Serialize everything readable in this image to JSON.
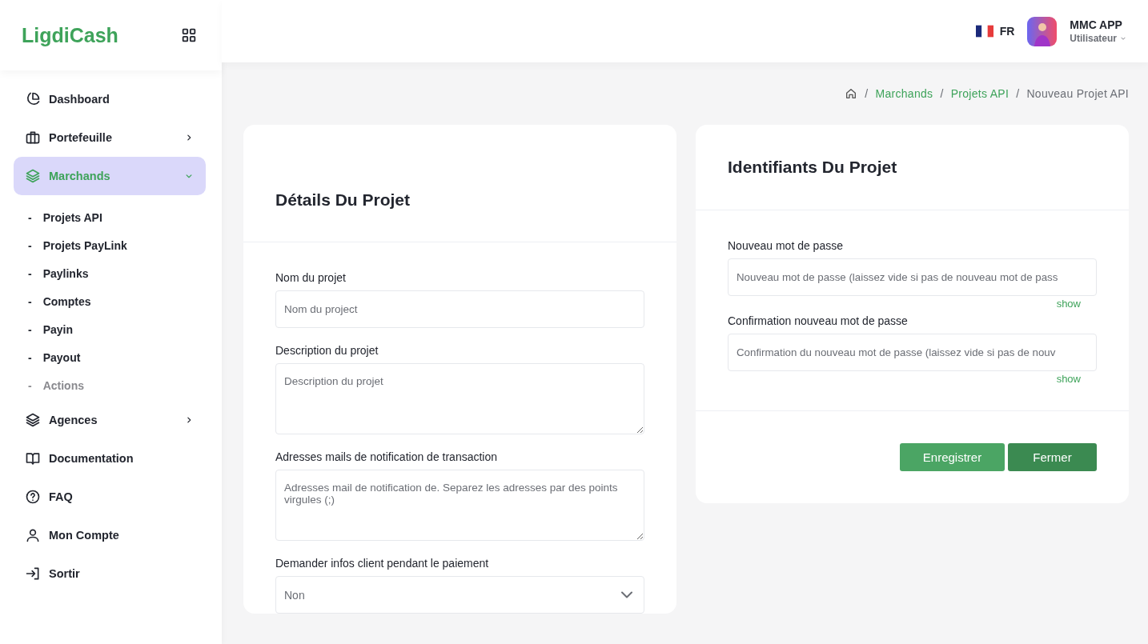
{
  "brand": {
    "name": "LigdiCash"
  },
  "header": {
    "language": "FR",
    "user_name": "MMC APP",
    "user_role": "Utilisateur"
  },
  "sidebar": {
    "items": [
      {
        "label": "Dashboard",
        "kind": "link",
        "selected": false
      },
      {
        "label": "Portefeuille",
        "kind": "group",
        "selected": false,
        "expanded": false
      },
      {
        "label": "Marchands",
        "kind": "group",
        "selected": true,
        "expanded": true,
        "children": [
          {
            "marker": "-",
            "label": "Projets API",
            "dimmed": false
          },
          {
            "marker": "-",
            "label": "Projets PayLink",
            "dimmed": false
          },
          {
            "marker": "-",
            "label": "Paylinks",
            "dimmed": false
          },
          {
            "marker": "-",
            "label": "Comptes",
            "dimmed": false
          },
          {
            "marker": "-",
            "label": "Payin",
            "dimmed": false
          },
          {
            "marker": "-",
            "label": "Payout",
            "dimmed": false
          },
          {
            "marker": "-",
            "label": "Actions",
            "dimmed": true
          }
        ]
      },
      {
        "label": "Agences",
        "kind": "group",
        "selected": false,
        "expanded": false
      },
      {
        "label": "Documentation",
        "kind": "link",
        "selected": false
      },
      {
        "label": "FAQ",
        "kind": "link",
        "selected": false
      },
      {
        "label": "Mon Compte",
        "kind": "link",
        "selected": false
      },
      {
        "label": "Sortir",
        "kind": "link",
        "selected": false
      }
    ]
  },
  "breadcrumb": [
    {
      "separator": "/",
      "label": "Marchands",
      "current": false
    },
    {
      "separator": "/",
      "label": "Projets API",
      "current": false
    },
    {
      "separator": "/",
      "label": "Nouveau Projet API",
      "current": true
    }
  ],
  "details_card": {
    "title": "Détails Du Projet",
    "fields": [
      {
        "kind": "input",
        "label": "Nom du projet",
        "placeholder": "Nom du project"
      },
      {
        "kind": "textarea",
        "label": "Description du projet",
        "placeholder": "Description du projet"
      },
      {
        "kind": "textarea",
        "label": "Adresses mails de notification de transaction",
        "placeholder": "Adresses mail de notification de. Separez les adresses par des points virgules (;)"
      },
      {
        "kind": "select",
        "label": "Demander infos client pendant le paiement",
        "value": "Non"
      }
    ]
  },
  "credentials_card": {
    "title": "Identifiants Du Projet",
    "fields": [
      {
        "kind": "password",
        "label": "Nouveau mot de passe",
        "placeholder": "Nouveau mot de passe (laissez vide si pas de nouveau mot de pass",
        "toggle": "show"
      },
      {
        "kind": "password",
        "label": "Confirmation nouveau mot de passe",
        "placeholder": "Confirmation du nouveau mot de passe (laissez vide si pas de nouv",
        "toggle": "show"
      }
    ],
    "buttons": [
      {
        "label": "Enregistrer",
        "kind": "primary"
      },
      {
        "label": "Fermer",
        "kind": "dark"
      }
    ]
  }
}
